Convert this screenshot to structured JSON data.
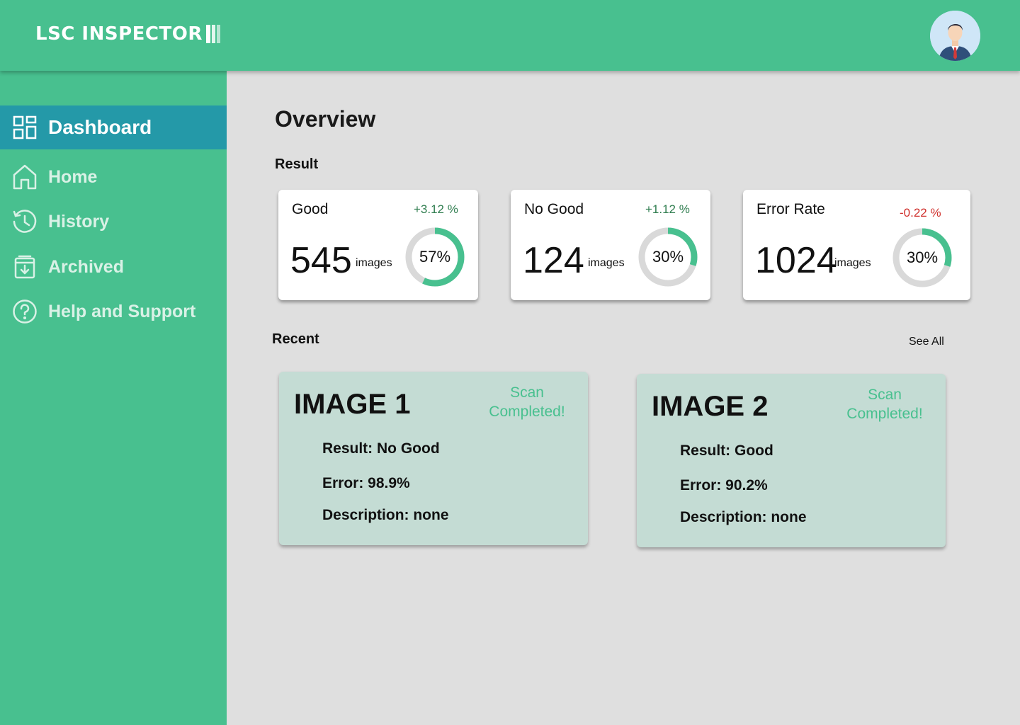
{
  "header": {
    "logo_text": "LSC INSPECTOR",
    "avatar_icon": "user-avatar-icon"
  },
  "sidebar": {
    "items": [
      {
        "label": "Dashboard",
        "icon": "dashboard-icon",
        "active": true
      },
      {
        "label": "Home",
        "icon": "home-icon",
        "active": false
      },
      {
        "label": "History",
        "icon": "history-icon",
        "active": false
      },
      {
        "label": "Archived",
        "icon": "archive-icon",
        "active": false
      },
      {
        "label": "Help and Support",
        "icon": "help-icon",
        "active": false
      }
    ]
  },
  "main": {
    "title": "Overview",
    "result_label": "Result",
    "recent_label": "Recent",
    "see_all_label": "See All"
  },
  "stats": [
    {
      "name": "Good",
      "change": "+3.12 %",
      "change_color": "#2f7d4f",
      "value": "545",
      "unit": "images",
      "percent_label": "57%",
      "percent": 57
    },
    {
      "name": "No Good",
      "change": "+1.12 %",
      "change_color": "#2f7d4f",
      "value": "124",
      "unit": "images",
      "percent_label": "30%",
      "percent": 30
    },
    {
      "name": "Error Rate",
      "change": "-0.22 %",
      "change_color": "#d0312d",
      "value": "1024",
      "unit": "images",
      "percent_label": "30%",
      "percent": 30
    }
  ],
  "recent": [
    {
      "title": "IMAGE 1",
      "status": "Scan Completed!",
      "result": "Result: No Good",
      "error": "Error: 98.9%",
      "description": "Description: none"
    },
    {
      "title": "IMAGE 2",
      "status": "Scan Completed!",
      "result": "Result: Good",
      "error": "Error: 90.2%",
      "description": "Description: none"
    }
  ],
  "colors": {
    "brand_green": "#48c08f",
    "active_nav": "#2499a8",
    "donut_track": "#d9d9d9",
    "recent_card_bg": "#c4dcd4",
    "positive_change": "#2f7d4f",
    "negative_change": "#d0312d"
  }
}
